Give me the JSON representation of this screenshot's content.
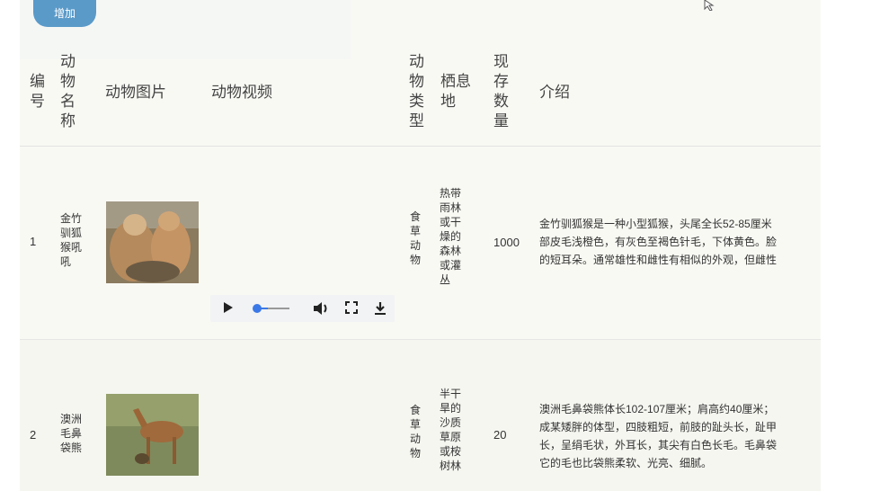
{
  "toolbar": {
    "add_label": "增加"
  },
  "table": {
    "headers": {
      "id": "编号",
      "name": "动物名称",
      "image": "动物图片",
      "video": "动物视频",
      "type": "动物类型",
      "habitat": "栖息地",
      "count": "现存数量",
      "intro": "介绍"
    },
    "rows": [
      {
        "id": "1",
        "name": "金竹驯狐猴吼吼",
        "type": "食草动物",
        "habitat": "热带雨林或干燥的森林或灌丛",
        "count": "1000",
        "intro": [
          "金竹驯狐猴是一种小型狐猴，头尾全长52-85厘米",
          "部皮毛浅橙色，有灰色至褐色针毛，下体黄色。脸",
          "的短耳朵。通常雄性和雌性有相似的外观，但雌性"
        ]
      },
      {
        "id": "2",
        "name": "澳洲毛鼻袋熊",
        "type": "食草动物",
        "habitat": "半干旱的沙质草原或桉树林",
        "count": "20",
        "intro": [
          "澳洲毛鼻袋熊体长102-107厘米；肩高约40厘米；",
          "成某矮胖的体型，四肢粗短，前肢的趾头长，趾甲",
          "长，呈绢毛状，外耳长，其尖有白色长毛。毛鼻袋",
          "它的毛也比袋熊柔软、光亮、细腻。"
        ]
      }
    ]
  },
  "player": {
    "icons": [
      "play-icon",
      "seek-slider",
      "volume-icon",
      "fullscreen-icon",
      "download-icon"
    ]
  },
  "colors": {
    "accent": "#5a9ac9",
    "panel": "#f9f9f4"
  }
}
